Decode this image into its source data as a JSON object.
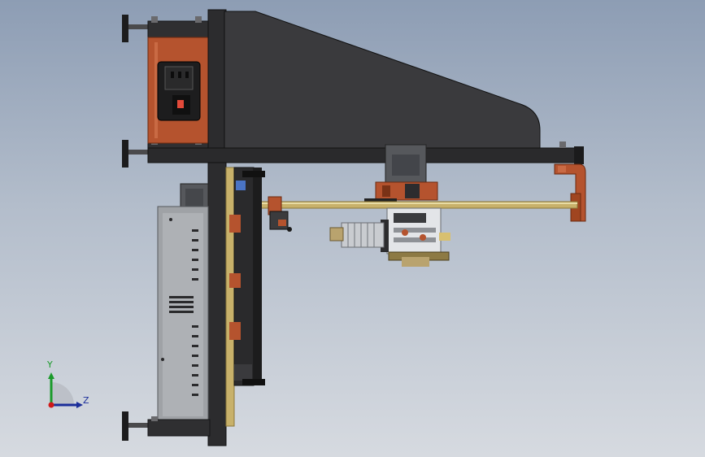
{
  "viewport": {
    "background_top": "#8d9db4",
    "background_bottom": "#d6dae0"
  },
  "colors": {
    "frame_dark": "#2f2f31",
    "frame_mid": "#3a3a3d",
    "copper": "#b5532e",
    "copper_dark": "#7a3216",
    "rod": "#c8b16a",
    "psu_gray": "#9fa2a6",
    "motor_gray": "#5c5e62",
    "hotend_silver": "#c9ccd0",
    "gear_brass": "#b9a36e"
  },
  "triad": {
    "y_label": "Y",
    "z_label": "Z",
    "y_color": "#1a9a2a",
    "z_color": "#1b2e9a",
    "origin_color": "#d01818",
    "icon": "coordinate-triad-icon"
  }
}
